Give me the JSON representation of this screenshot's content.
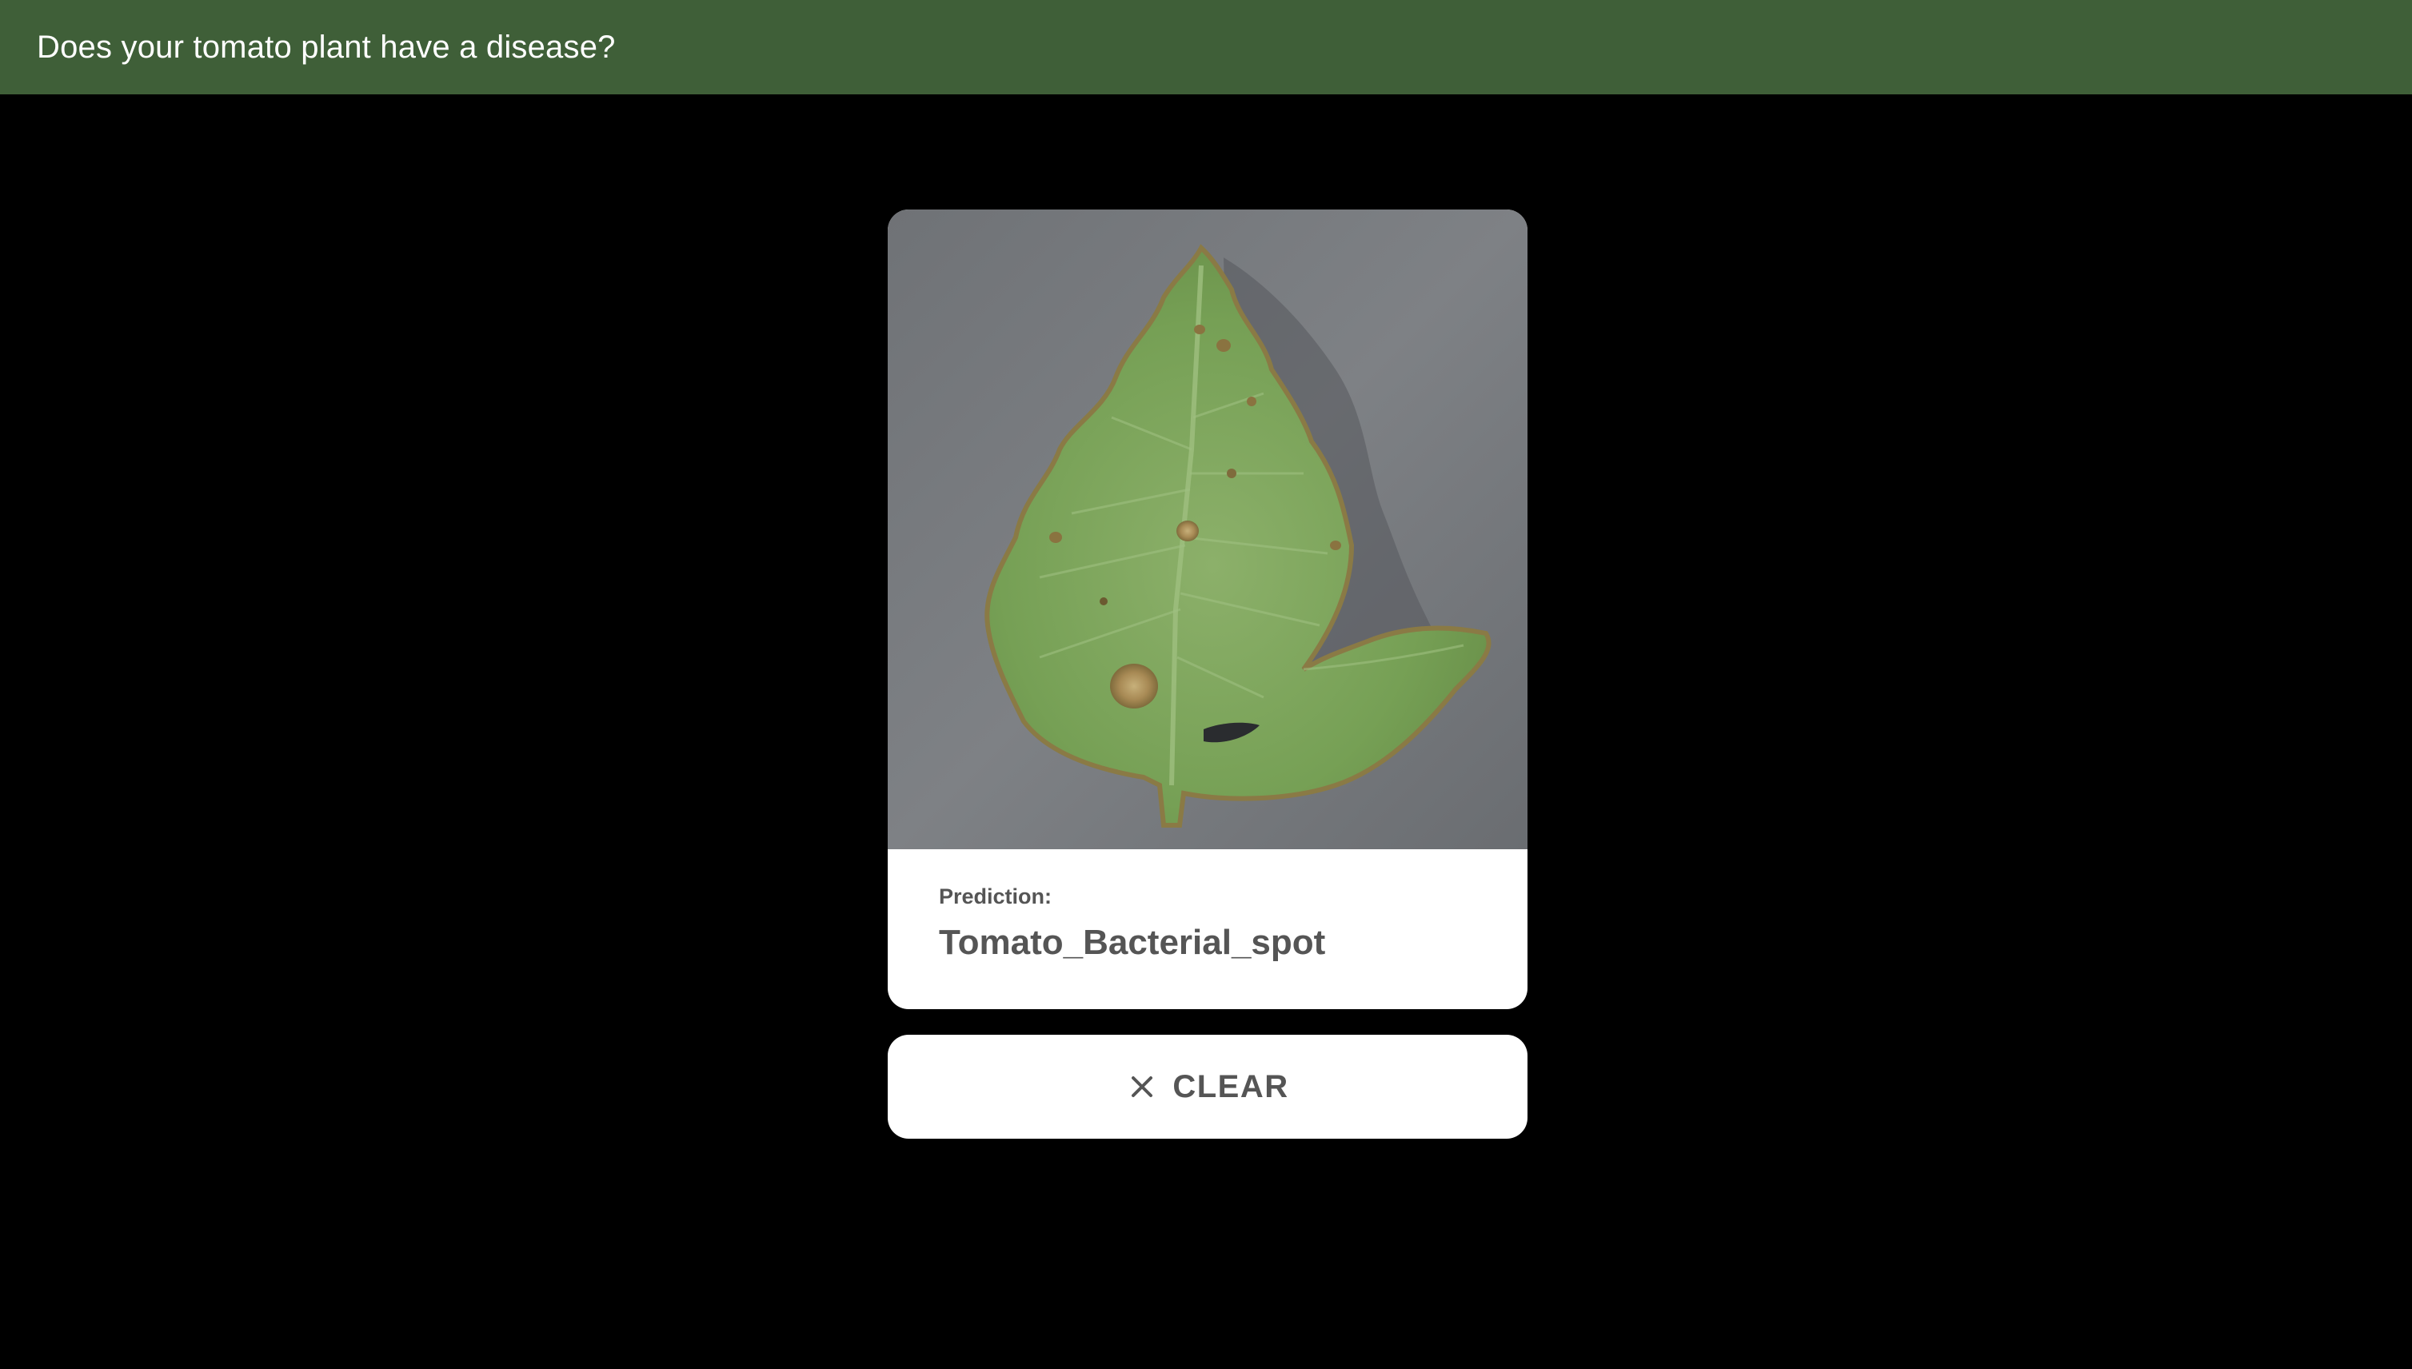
{
  "app": {
    "title": "Does your tomato plant have a disease?"
  },
  "result": {
    "image": {
      "subject": "tomato leaf photo",
      "background_color": "#7a7d80",
      "leaf_color": "#7aa35a"
    },
    "prediction_label": "Prediction:",
    "prediction_value": "Tomato_Bacterial_spot"
  },
  "actions": {
    "clear_label": "CLEAR",
    "clear_icon": "close-icon"
  },
  "colors": {
    "header_background": "#3f5f38",
    "page_background": "#000000",
    "card_background": "#ffffff",
    "text_muted": "#555555"
  }
}
